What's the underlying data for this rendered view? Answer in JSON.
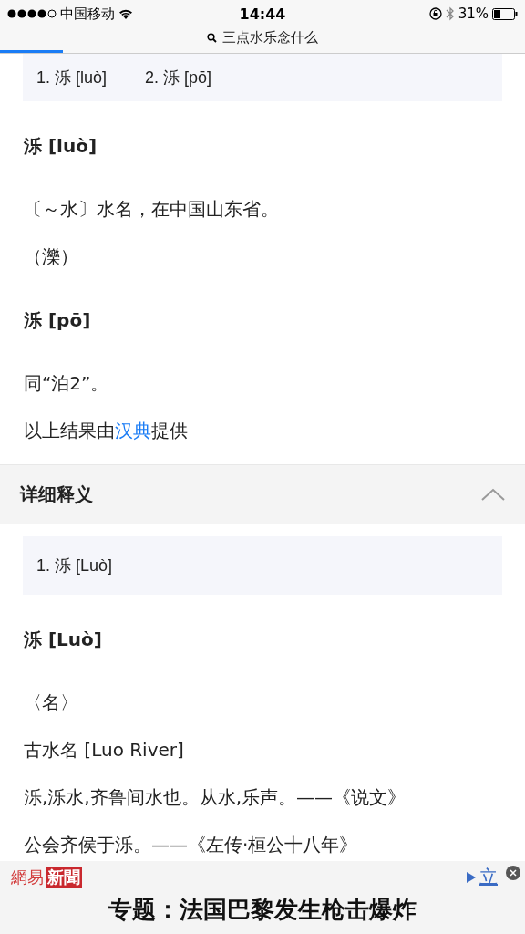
{
  "status_bar": {
    "carrier": "中国移动",
    "time": "14:44",
    "battery": "31%"
  },
  "address_bar": {
    "query": "三点水乐念什么",
    "level": 0.12
  },
  "blocks": [
    {
      "kind": "index_box",
      "items": [
        "1. 泺 [luò]",
        "2. 泺 [pō]"
      ]
    },
    {
      "kind": "heading",
      "text": "泺 [luò]"
    },
    {
      "kind": "text",
      "text": "〔～水〕水名，在中国山东省。"
    },
    {
      "kind": "text",
      "text": "（濼）"
    },
    {
      "kind": "heading",
      "text": "泺 [pō]"
    },
    {
      "kind": "text",
      "text": "同“泊2”。"
    },
    {
      "kind": "source",
      "before": "以上结果由",
      "link": "汉典",
      "after": "提供"
    },
    {
      "kind": "section",
      "text": "详细释义",
      "expanded": true
    },
    {
      "kind": "index_box",
      "items": [
        "1. 泺 [Luò]"
      ]
    },
    {
      "kind": "heading",
      "text": "泺 [Luò]"
    },
    {
      "kind": "text",
      "text": "〈名〉"
    },
    {
      "kind": "text",
      "text": "古水名 [Luo River]"
    },
    {
      "kind": "text",
      "text": "泺,泺水,齐鲁间水也。从水,乐声。——《说文》"
    },
    {
      "kind": "text",
      "text": "公会齐侯于泺。——《左传·桓公十八年》"
    }
  ],
  "ad": {
    "logo_left": "網易",
    "logo_right": "新聞",
    "link": "立",
    "headline": "专题：法国巴黎发生枪击爆炸"
  }
}
